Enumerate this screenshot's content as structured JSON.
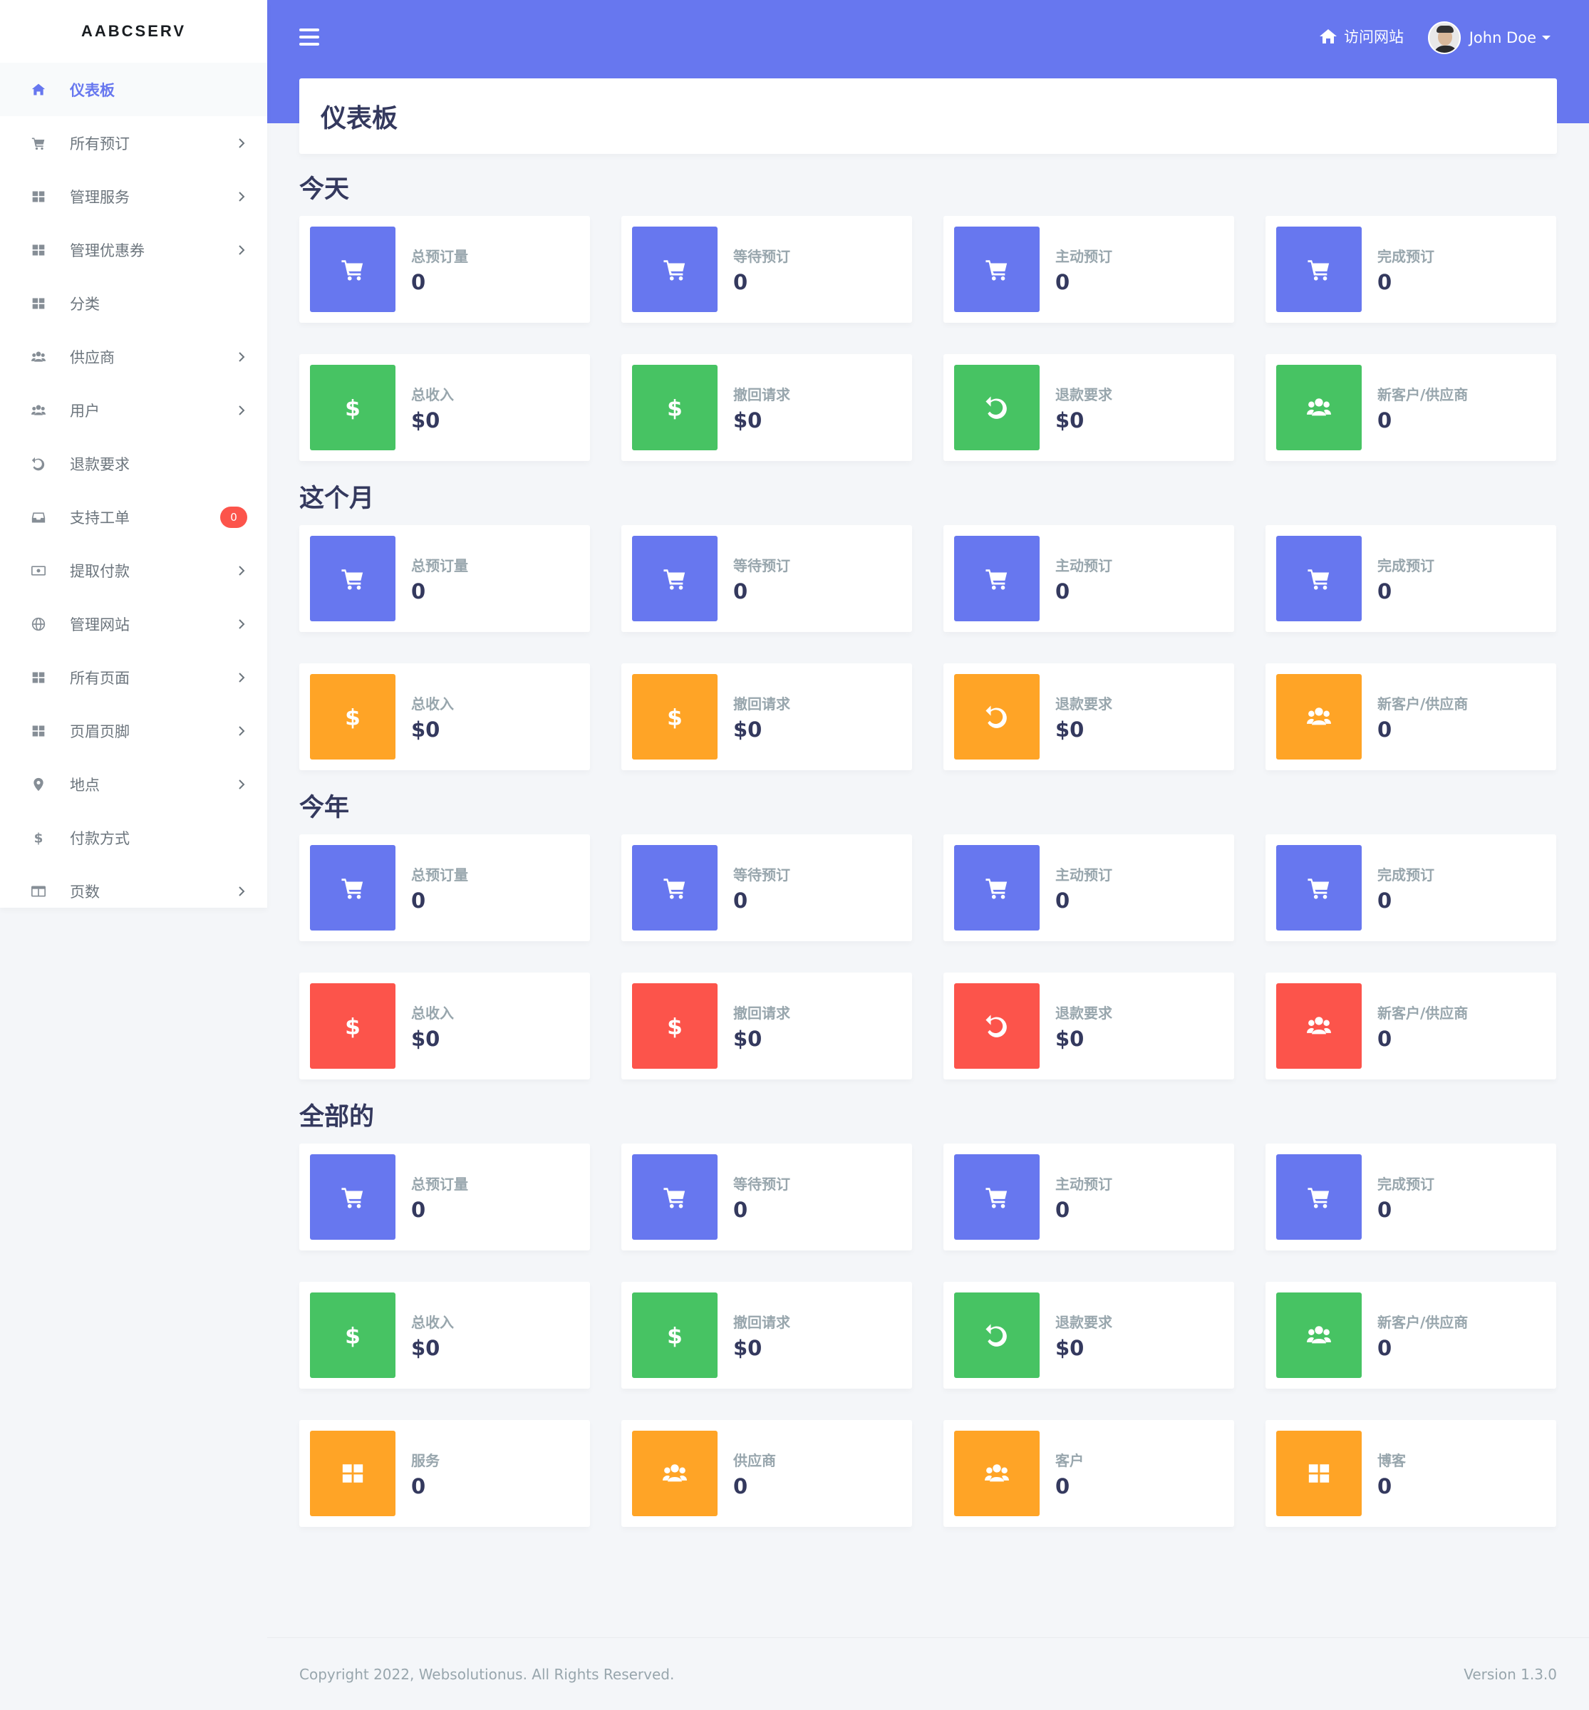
{
  "sidebar": {
    "brand": "AABCSERV",
    "items": [
      {
        "label": "仪表板",
        "icon": "home-icon",
        "active": true,
        "chevron": false
      },
      {
        "label": "所有预订",
        "icon": "cart-icon",
        "chevron": true
      },
      {
        "label": "管理服务",
        "icon": "grid-icon",
        "chevron": true
      },
      {
        "label": "管理优惠券",
        "icon": "grid-icon",
        "chevron": true
      },
      {
        "label": "分类",
        "icon": "grid-icon",
        "chevron": false
      },
      {
        "label": "供应商",
        "icon": "users-icon",
        "chevron": true
      },
      {
        "label": "用户",
        "icon": "users-icon",
        "chevron": true
      },
      {
        "label": "退款要求",
        "icon": "undo-icon",
        "chevron": false
      },
      {
        "label": "支持工单",
        "icon": "inbox-icon",
        "chevron": false,
        "badge": "0"
      },
      {
        "label": "提取付款",
        "icon": "money-icon",
        "chevron": true
      },
      {
        "label": "管理网站",
        "icon": "globe-icon",
        "chevron": true
      },
      {
        "label": "所有页面",
        "icon": "grid-icon",
        "chevron": true
      },
      {
        "label": "页眉页脚",
        "icon": "grid-icon",
        "chevron": true
      },
      {
        "label": "地点",
        "icon": "map-marker-icon",
        "chevron": true
      },
      {
        "label": "付款方式",
        "icon": "dollar-icon",
        "chevron": false
      },
      {
        "label": "页数",
        "icon": "columns-icon",
        "chevron": true
      }
    ]
  },
  "topbar": {
    "visit_label": "访问网站",
    "user_name": "John Doe"
  },
  "page_title": "仪表板",
  "colors": {
    "primary": "#6777ef",
    "success": "#47c363",
    "warning": "#ffa426",
    "danger": "#fc544b"
  },
  "sections": [
    {
      "title": "今天",
      "rows": [
        {
          "color": "primary",
          "cards": [
            {
              "label": "总预订量",
              "value": "0",
              "icon": "cart-icon"
            },
            {
              "label": "等待预订",
              "value": "0",
              "icon": "cart-icon"
            },
            {
              "label": "主动预订",
              "value": "0",
              "icon": "cart-icon"
            },
            {
              "label": "完成预订",
              "value": "0",
              "icon": "cart-icon"
            }
          ]
        },
        {
          "color": "success",
          "cards": [
            {
              "label": "总收入",
              "value": "$0",
              "icon": "dollar-icon"
            },
            {
              "label": "撤回请求",
              "value": "$0",
              "icon": "dollar-icon"
            },
            {
              "label": "退款要求",
              "value": "$0",
              "icon": "undo-icon"
            },
            {
              "label": "新客户/供应商",
              "value": "0",
              "icon": "users-icon"
            }
          ]
        }
      ]
    },
    {
      "title": "这个月",
      "rows": [
        {
          "color": "primary",
          "cards": [
            {
              "label": "总预订量",
              "value": "0",
              "icon": "cart-icon"
            },
            {
              "label": "等待预订",
              "value": "0",
              "icon": "cart-icon"
            },
            {
              "label": "主动预订",
              "value": "0",
              "icon": "cart-icon"
            },
            {
              "label": "完成预订",
              "value": "0",
              "icon": "cart-icon"
            }
          ]
        },
        {
          "color": "warning",
          "cards": [
            {
              "label": "总收入",
              "value": "$0",
              "icon": "dollar-icon"
            },
            {
              "label": "撤回请求",
              "value": "$0",
              "icon": "dollar-icon"
            },
            {
              "label": "退款要求",
              "value": "$0",
              "icon": "undo-icon"
            },
            {
              "label": "新客户/供应商",
              "value": "0",
              "icon": "users-icon"
            }
          ]
        }
      ]
    },
    {
      "title": "今年",
      "rows": [
        {
          "color": "primary",
          "cards": [
            {
              "label": "总预订量",
              "value": "0",
              "icon": "cart-icon"
            },
            {
              "label": "等待预订",
              "value": "0",
              "icon": "cart-icon"
            },
            {
              "label": "主动预订",
              "value": "0",
              "icon": "cart-icon"
            },
            {
              "label": "完成预订",
              "value": "0",
              "icon": "cart-icon"
            }
          ]
        },
        {
          "color": "danger",
          "cards": [
            {
              "label": "总收入",
              "value": "$0",
              "icon": "dollar-icon"
            },
            {
              "label": "撤回请求",
              "value": "$0",
              "icon": "dollar-icon"
            },
            {
              "label": "退款要求",
              "value": "$0",
              "icon": "undo-icon"
            },
            {
              "label": "新客户/供应商",
              "value": "0",
              "icon": "users-icon"
            }
          ]
        }
      ]
    },
    {
      "title": "全部的",
      "rows": [
        {
          "color": "primary",
          "cards": [
            {
              "label": "总预订量",
              "value": "0",
              "icon": "cart-icon"
            },
            {
              "label": "等待预订",
              "value": "0",
              "icon": "cart-icon"
            },
            {
              "label": "主动预订",
              "value": "0",
              "icon": "cart-icon"
            },
            {
              "label": "完成预订",
              "value": "0",
              "icon": "cart-icon"
            }
          ]
        },
        {
          "color": "success",
          "cards": [
            {
              "label": "总收入",
              "value": "$0",
              "icon": "dollar-icon"
            },
            {
              "label": "撤回请求",
              "value": "$0",
              "icon": "dollar-icon"
            },
            {
              "label": "退款要求",
              "value": "$0",
              "icon": "undo-icon"
            },
            {
              "label": "新客户/供应商",
              "value": "0",
              "icon": "users-icon"
            }
          ]
        },
        {
          "color": "warning",
          "cards": [
            {
              "label": "服务",
              "value": "0",
              "icon": "grid-icon"
            },
            {
              "label": "供应商",
              "value": "0",
              "icon": "users-icon"
            },
            {
              "label": "客户",
              "value": "0",
              "icon": "users-icon"
            },
            {
              "label": "博客",
              "value": "0",
              "icon": "grid-icon"
            }
          ]
        }
      ]
    }
  ],
  "footer": {
    "copyright": "Copyright 2022, Websolutionus. All Rights Reserved.",
    "version": "Version 1.3.0"
  }
}
